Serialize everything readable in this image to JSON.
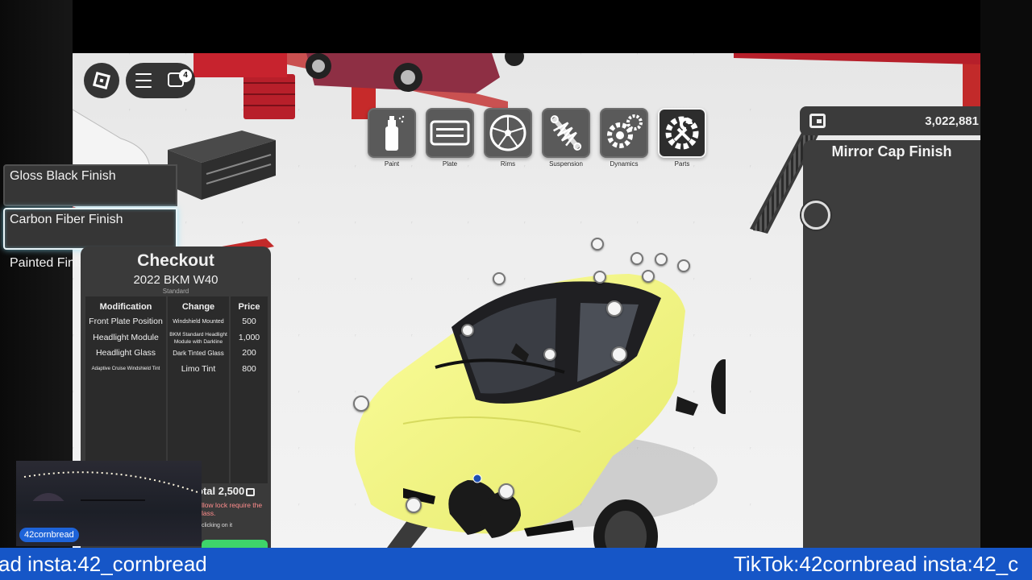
{
  "hud": {
    "roblox_icon": "roblox-logo-icon",
    "menu_icon": "hamburger-menu-icon",
    "chat_icon": "chat-icon",
    "chat_badge": "4"
  },
  "toolbar": {
    "tools": [
      {
        "label": "Paint",
        "icon": "spray-can-icon",
        "active": false
      },
      {
        "label": "Plate",
        "icon": "license-plate-icon",
        "active": false
      },
      {
        "label": "Rims",
        "icon": "rim-icon",
        "active": false
      },
      {
        "label": "Suspension",
        "icon": "coilover-icon",
        "active": false
      },
      {
        "label": "Dynamics",
        "icon": "gears-icon",
        "active": false
      },
      {
        "label": "Parts",
        "icon": "wrench-gear-icon",
        "active": true
      }
    ]
  },
  "currency": {
    "icon": "wallet-icon",
    "value": "3,022,881"
  },
  "finish_panel": {
    "title": "Mirror Cap Finish",
    "options": [
      {
        "label": "Gloss Black Finish",
        "selected": false
      },
      {
        "label": "Carbon Fiber Finish",
        "selected": true
      },
      {
        "label": "Painted Finish",
        "selected": false
      }
    ]
  },
  "checkout": {
    "title": "Checkout",
    "car": "2022 BKM W40",
    "trim": "Standard",
    "headers": {
      "modification": "Modification",
      "change": "Change",
      "price": "Price"
    },
    "rows": [
      {
        "modification": "Front Plate Position",
        "change": "Windshield Mounted",
        "price": "500"
      },
      {
        "modification": "Headlight Module",
        "change": "BKM Standard Headlight Module with Darkline Accents",
        "price": "1,000"
      },
      {
        "modification": "Headlight Glass",
        "change": "Dark Tinted Glass",
        "price": "200"
      },
      {
        "modification": "Adaptive Cruise Windshield Tint",
        "change": "Limo Tint",
        "price": "800"
      }
    ],
    "total": "otal 2,500",
    "note": "llow lock require the lass.",
    "hint": "clicking on it"
  },
  "stream": {
    "webcam_name": "42cornbread",
    "ticker_left": "ad insta:42_cornbread",
    "ticker_right": "TikTok:42cornbread insta:42_c"
  },
  "colors": {
    "car_paint": "#f0f58c",
    "ticker_bg": "#1656c7",
    "panel_bg": "#3d3d3d",
    "selected_glow": "#8ce6ff",
    "buy_green": "#3ed46a"
  }
}
